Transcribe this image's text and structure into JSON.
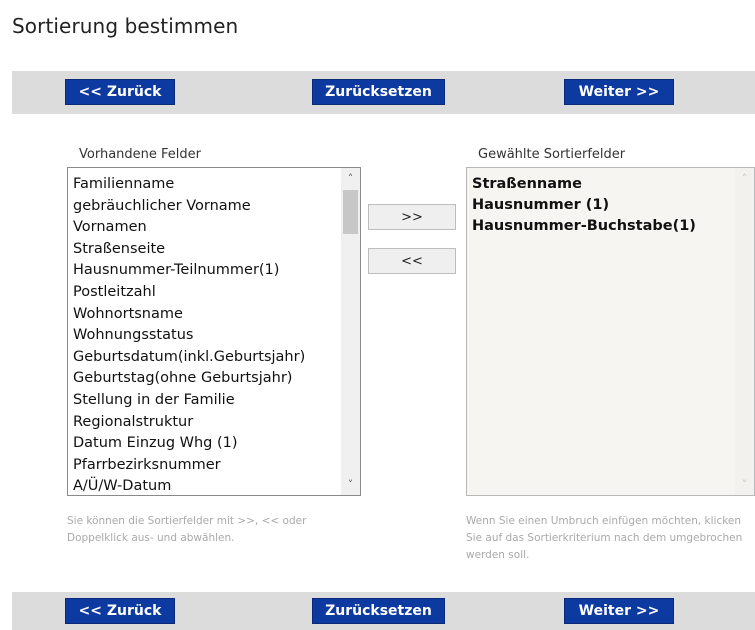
{
  "title": "Sortierung bestimmen",
  "buttons": {
    "back": "<< Zurück",
    "reset": "Zurücksetzen",
    "next": "Weiter >>"
  },
  "available": {
    "label": "Vorhandene Felder",
    "items": [
      "Familienname",
      "gebräuchlicher Vorname",
      "Vornamen",
      "Straßenseite",
      "Hausnummer-Teilnummer(1)",
      "Postleitzahl",
      "Wohnortsname",
      "Wohnungsstatus",
      "Geburtsdatum(inkl.Geburtsjahr)",
      "Geburtstag(ohne Geburtsjahr)",
      "Stellung in der Familie",
      "Regionalstruktur",
      "Datum Einzug Whg (1)",
      "Pfarrbezirksnummer",
      "A/Ü/W-Datum"
    ],
    "help": "Sie können die Sortierfelder mit >>, << oder Doppelklick aus- und abwählen."
  },
  "selected": {
    "label": "Gewählte Sortierfelder",
    "items": [
      "Straßenname",
      "Hausnummer (1)",
      "Hausnummer-Buchstabe(1)"
    ],
    "help": "Wenn Sie einen Umbruch einfügen möchten, klicken Sie auf das Sortierkriterium nach dem umgebrochen werden soll."
  },
  "movers": {
    "add": ">>",
    "remove": "<<"
  },
  "colors": {
    "button_bg": "#0d3aa0",
    "bar_bg": "#dcdcdc",
    "help_text": "#a9a9a9"
  }
}
